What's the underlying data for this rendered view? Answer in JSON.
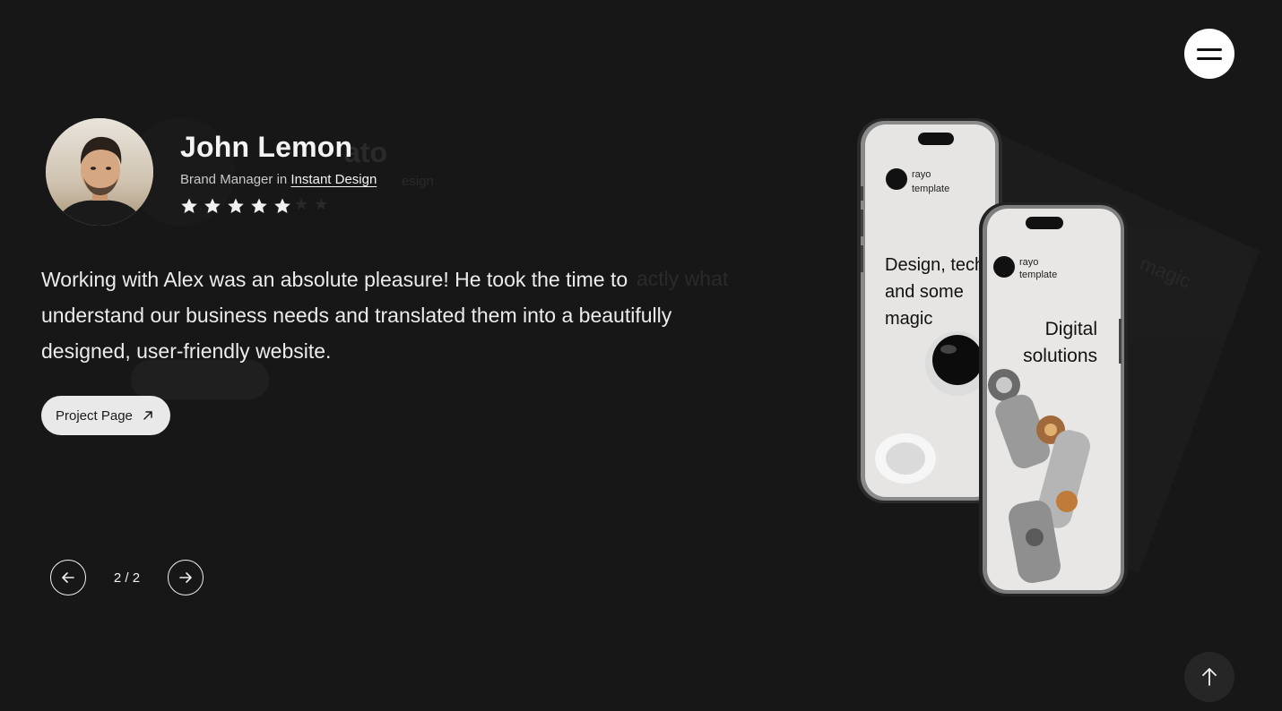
{
  "menu": {
    "icon": "hamburger-menu-icon"
  },
  "testimonial": {
    "name": "John Lemon",
    "role_prefix": "Brand Manager in",
    "company": "Instant Design",
    "rating": 5,
    "quote": "Working with Alex was an absolute pleasure! He took the time to understand our business needs and translated them into a beautifully designed, user-friendly website.",
    "button_label": "Project Page",
    "button_icon": "arrow-up-right-icon"
  },
  "ghost_slide": {
    "name_fragment": "ato",
    "role_fragment": "esign",
    "text_fragment": "actly what"
  },
  "slider": {
    "counter": "2 / 2",
    "prev_icon": "arrow-left-icon",
    "next_icon": "arrow-right-icon"
  },
  "mockup": {
    "brand": [
      "rayo",
      "template"
    ],
    "back_screen_headline": [
      "Design, tech",
      "and some",
      "magic"
    ],
    "front_screen_headline": [
      "Digital",
      "solutions"
    ]
  },
  "scroll_top": {
    "icon": "arrow-up-icon"
  }
}
